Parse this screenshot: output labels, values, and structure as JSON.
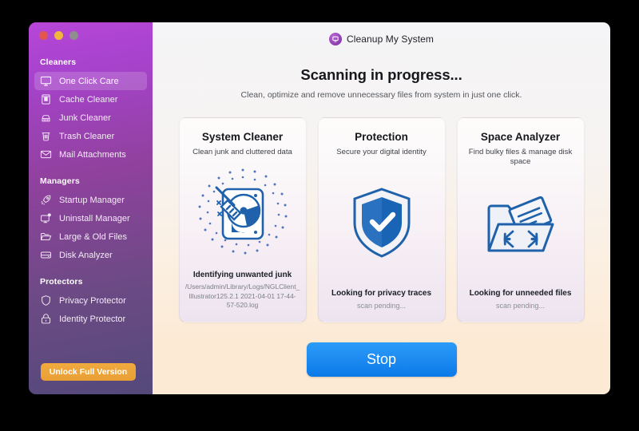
{
  "window": {
    "traffic_lights": [
      "close",
      "minimize",
      "zoom"
    ]
  },
  "sidebar": {
    "sections": [
      {
        "label": "Cleaners",
        "items": [
          {
            "label": "One Click Care",
            "icon": "monitor-icon",
            "active": true
          },
          {
            "label": "Cache Cleaner",
            "icon": "cache-icon",
            "active": false
          },
          {
            "label": "Junk Cleaner",
            "icon": "broom-icon",
            "active": false
          },
          {
            "label": "Trash Cleaner",
            "icon": "trash-icon",
            "active": false
          },
          {
            "label": "Mail Attachments",
            "icon": "envelope-icon",
            "active": false
          }
        ]
      },
      {
        "label": "Managers",
        "items": [
          {
            "label": "Startup Manager",
            "icon": "rocket-icon",
            "active": false
          },
          {
            "label": "Uninstall Manager",
            "icon": "monitor-gear-icon",
            "active": false
          },
          {
            "label": "Large & Old Files",
            "icon": "folder-icon",
            "active": false
          },
          {
            "label": "Disk Analyzer",
            "icon": "disk-icon",
            "active": false
          }
        ]
      },
      {
        "label": "Protectors",
        "items": [
          {
            "label": "Privacy Protector",
            "icon": "shield-icon",
            "active": false
          },
          {
            "label": "Identity Protector",
            "icon": "lock-icon",
            "active": false
          }
        ]
      }
    ],
    "unlock_button": "Unlock Full Version"
  },
  "header": {
    "brand_icon": "cleanup-app-icon",
    "brand_title": "Cleanup My System"
  },
  "main": {
    "title": "Scanning in progress...",
    "subtitle": "Clean, optimize and remove unnecessary files from system in just one click.",
    "stop_button": "Stop"
  },
  "cards": [
    {
      "title": "System Cleaner",
      "subtitle": "Clean junk and cluttered data",
      "icon": "hard-drive-broom-icon",
      "status": "Identifying unwanted junk",
      "detail": "/Users/admin/Library/Logs/NGLClient_Illustrator125.2.1 2021-04-01 17-44-57-520.log",
      "pending": false
    },
    {
      "title": "Protection",
      "subtitle": "Secure your digital identity",
      "icon": "shield-check-icon",
      "status": "Looking for privacy traces",
      "detail": "scan pending...",
      "pending": true
    },
    {
      "title": "Space Analyzer",
      "subtitle": "Find bulky files & manage disk space",
      "icon": "folder-expand-icon",
      "status": "Looking for unneeded files",
      "detail": "scan pending...",
      "pending": true
    }
  ],
  "colors": {
    "sidebar_top": "#b746d8",
    "sidebar_bottom": "#54497a",
    "accent_orange": "#eea43a",
    "accent_blue": "#1f8cf2",
    "icon_blue": "#1f62ab"
  }
}
